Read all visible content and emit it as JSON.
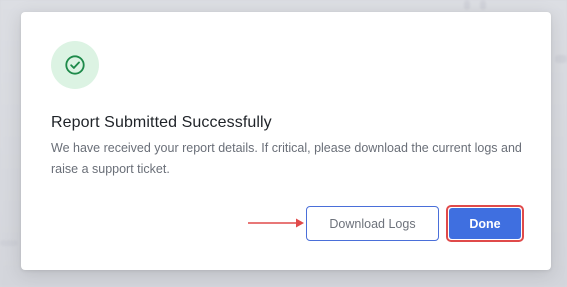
{
  "dialog": {
    "title": "Report Submitted Successfully",
    "message": "We have received your report details. If critical, please download the current logs and raise a support ticket.",
    "icon": "check-circle-icon"
  },
  "actions": {
    "download_label": "Download Logs",
    "done_label": "Done"
  },
  "colors": {
    "success_bg": "#dcf3e3",
    "success_fg": "#1e8a4a",
    "primary": "#3f6fe0",
    "secondary_border": "#4a6fd9",
    "annotation": "#e04a4a"
  }
}
